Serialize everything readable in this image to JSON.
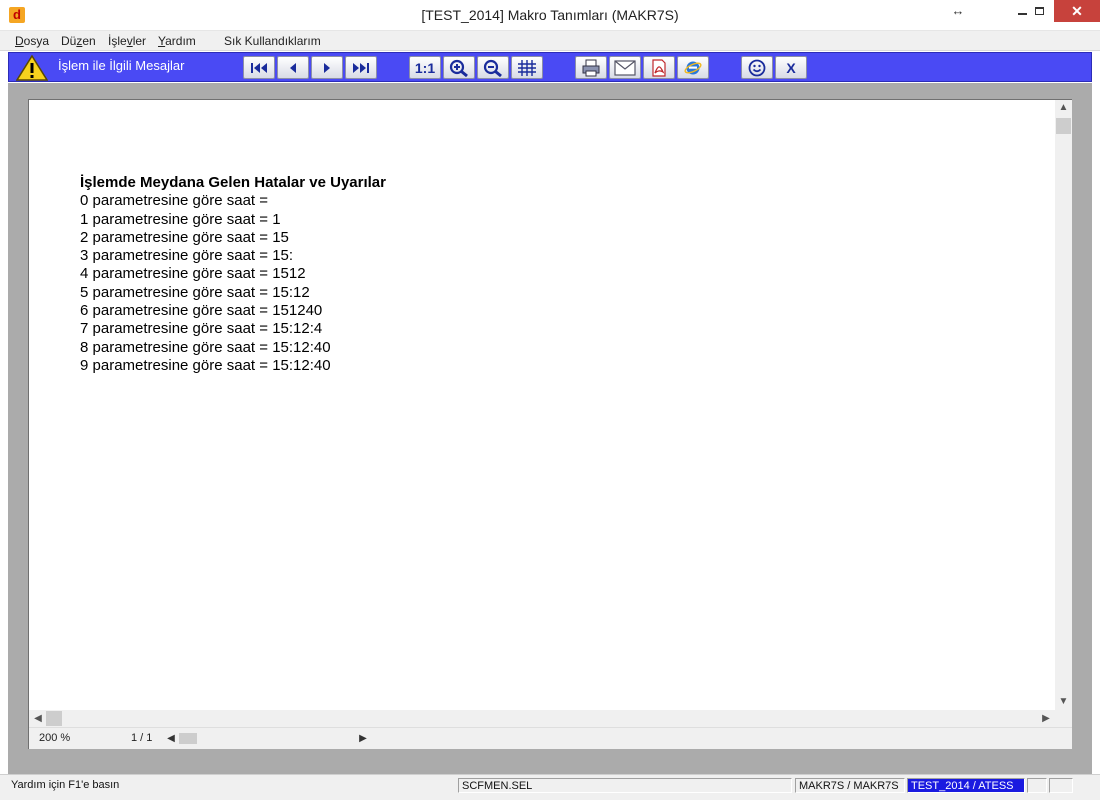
{
  "window": {
    "title": "[TEST_2014] Makro Tanımları (MAKR7S)",
    "app_icon_letter": "d",
    "resize_glyph": "↔",
    "close_glyph": "✕"
  },
  "menu": {
    "items": [
      {
        "label": "Dosya",
        "accel": "D"
      },
      {
        "label": "Düzen",
        "accel": "z"
      },
      {
        "label": "İşlevler",
        "accel": "v"
      },
      {
        "label": "Yardım",
        "accel": "Y"
      },
      {
        "label": "Sık Kullandıklarım",
        "accel": ""
      }
    ]
  },
  "toolbar": {
    "title": "İşlem ile İlgili Mesajlar",
    "actual_size_label": "1:1",
    "close_label": "X",
    "accent": "#4a4af4",
    "icons": [
      "first-page-icon",
      "prev-page-icon",
      "next-page-icon",
      "last-page-icon",
      "actual-size-icon",
      "zoom-in-icon",
      "zoom-out-icon",
      "grid-icon",
      "print-icon",
      "email-icon",
      "pdf-icon",
      "browser-icon",
      "smiley-icon",
      "close-icon"
    ]
  },
  "report": {
    "heading": "İşlemde Meydana Gelen Hatalar ve Uyarılar",
    "lines": [
      "0 parametresine göre saat =",
      "1 parametresine göre saat = 1",
      "2 parametresine göre saat = 15",
      "3 parametresine göre saat = 15:",
      "4 parametresine göre saat = 1512",
      "5 parametresine göre saat = 15:12",
      "6 parametresine göre saat = 151240",
      "7 parametresine göre saat = 15:12:4",
      "8 parametresine göre saat = 15:12:40",
      "9 parametresine göre saat = 15:12:40"
    ]
  },
  "viewer_footer": {
    "zoom": "200 %",
    "page": "1 / 1"
  },
  "statusbar": {
    "help": "Yardım için F1'e basın",
    "file": "SCFMEN.SEL",
    "macro": "MAKR7S / MAKR7S",
    "company": "TEST_2014 / ATESS",
    "company_bg": "#1a1ae0"
  }
}
